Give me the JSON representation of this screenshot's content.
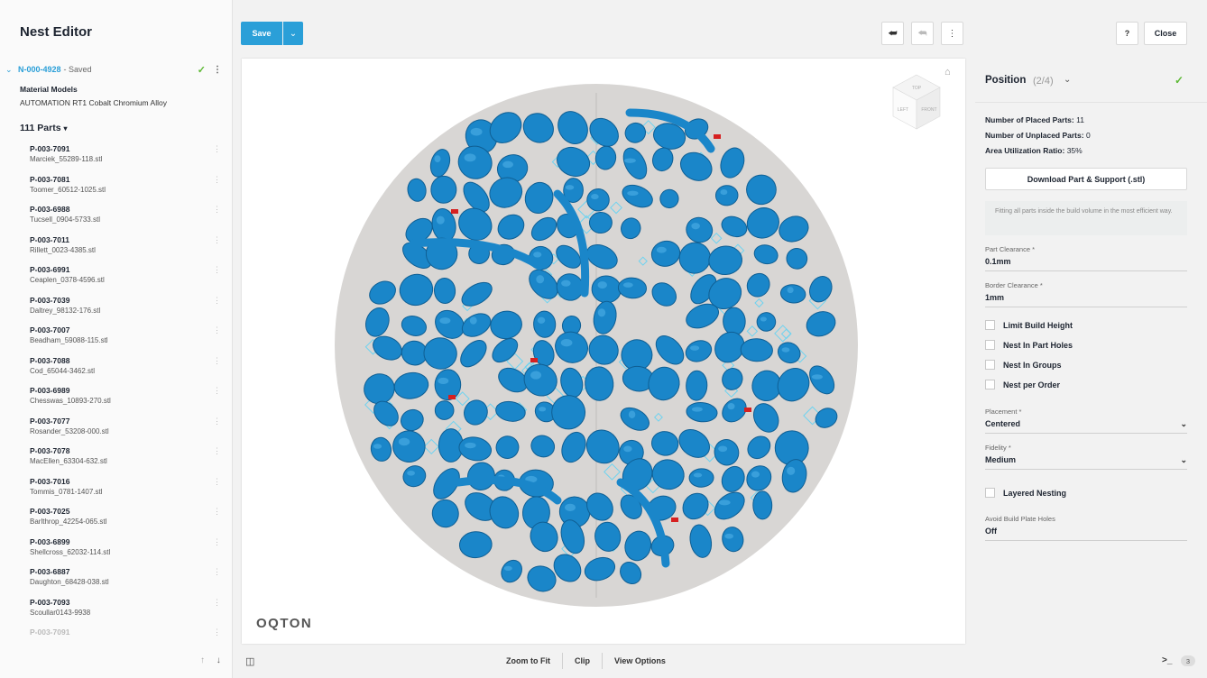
{
  "app": {
    "title": "Nest Editor"
  },
  "job": {
    "id": "N-000-4928",
    "status": "- Saved"
  },
  "material": {
    "label": "Material Models",
    "value": "AUTOMATION RT1 Cobalt Chromium Alloy"
  },
  "parts": {
    "header": "111 Parts",
    "items": [
      {
        "id": "P-003-7091",
        "file": "Marciek_55289-118.stl"
      },
      {
        "id": "P-003-7081",
        "file": "Toomer_60512-1025.stl"
      },
      {
        "id": "P-003-6988",
        "file": "Tucsell_0904-5733.stl"
      },
      {
        "id": "P-003-7011",
        "file": "Rillett_0023-4385.stl"
      },
      {
        "id": "P-003-6991",
        "file": "Ceaplen_0378-4596.stl"
      },
      {
        "id": "P-003-7039",
        "file": "Daltrey_98132-176.stl"
      },
      {
        "id": "P-003-7007",
        "file": "Beadham_59088-115.stl"
      },
      {
        "id": "P-003-7088",
        "file": "Cod_65044-3462.stl"
      },
      {
        "id": "P-003-6989",
        "file": "Chesswas_10893-270.stl"
      },
      {
        "id": "P-003-7077",
        "file": "Rosander_53208-000.stl"
      },
      {
        "id": "P-003-7078",
        "file": "MacEllen_63304-632.stl"
      },
      {
        "id": "P-003-7016",
        "file": "Tommis_0781-1407.stl"
      },
      {
        "id": "P-003-7025",
        "file": "Barlthrop_42254-065.stl"
      },
      {
        "id": "P-003-6899",
        "file": "Shellcross_62032-114.stl"
      },
      {
        "id": "P-003-6887",
        "file": "Daughton_68428-038.stl"
      },
      {
        "id": "P-003-7093",
        "file": "Scoullar0143-9938"
      },
      {
        "id": "P-003-7091",
        "file": ""
      }
    ]
  },
  "toolbar": {
    "save_label": "Save",
    "help_label": "?",
    "close_label": "Close"
  },
  "viewport": {
    "brand": "OQTON",
    "cube_top": "TOP",
    "cube_left": "LEFT",
    "cube_front": "FRONT"
  },
  "bottom": {
    "zoom_fit": "Zoom to Fit",
    "clip": "Clip",
    "view_options": "View Options",
    "console_symbol": ">_",
    "console_count": "3"
  },
  "position": {
    "title": "Position",
    "step": "(2/4)",
    "placed_label": "Number of Placed Parts:",
    "placed_value": "11",
    "unplaced_label": "Number of Unplaced Parts:",
    "unplaced_value": "0",
    "util_label": "Area Utilization Ratio:",
    "util_value": "35%",
    "download_label": "Download Part & Support (.stl)",
    "hint": "Fitting all parts inside the build volume in the most efficient way.",
    "part_clearance_label": "Part Clearance *",
    "part_clearance_value": "0.1mm",
    "border_clearance_label": "Border Clearance *",
    "border_clearance_value": "1mm",
    "checkboxes": [
      {
        "label": "Limit Build Height",
        "checked": false
      },
      {
        "label": "Nest In Part Holes",
        "checked": false
      },
      {
        "label": "Nest In Groups",
        "checked": false
      },
      {
        "label": "Nest per Order",
        "checked": false
      }
    ],
    "placement_label": "Placement *",
    "placement_value": "Centered",
    "fidelity_label": "Fidelity *",
    "fidelity_value": "Medium",
    "layered_label": "Layered Nesting",
    "avoid_holes_label": "Avoid Build Plate Holes",
    "avoid_holes_value": "Off"
  },
  "colors": {
    "accent": "#2a9fd8",
    "part": "#1a86c9",
    "support": "#6fd3f0",
    "plate": "#d8d6d4",
    "success": "#5db934"
  }
}
